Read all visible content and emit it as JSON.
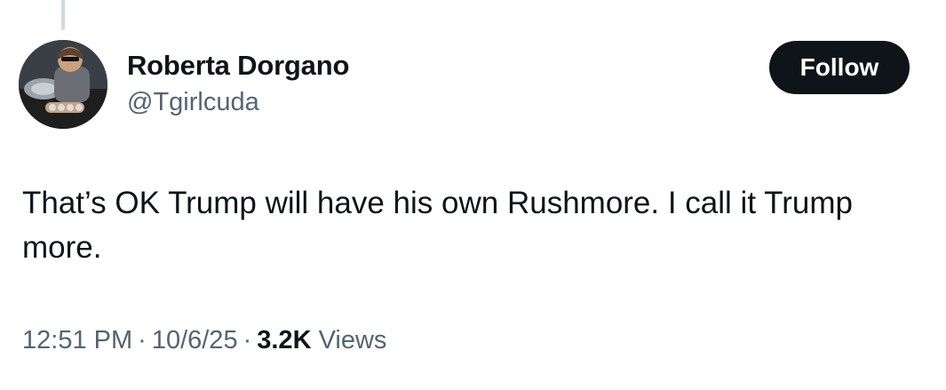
{
  "author": {
    "display_name": "Roberta Dorgano",
    "handle": "@Tgirlcuda"
  },
  "follow_button": {
    "label": "Follow"
  },
  "tweet": {
    "text": "That’s OK Trump will have his own Rushmore. I call it Trump more."
  },
  "meta": {
    "time": "12:51 PM",
    "date": "10/6/25",
    "separator": "·",
    "views_count": "3.2K",
    "views_label": "Views"
  },
  "colors": {
    "text_primary": "#0f1419",
    "text_secondary": "#536471",
    "button_bg": "#0f1419",
    "thread_line": "#cfd9de"
  }
}
